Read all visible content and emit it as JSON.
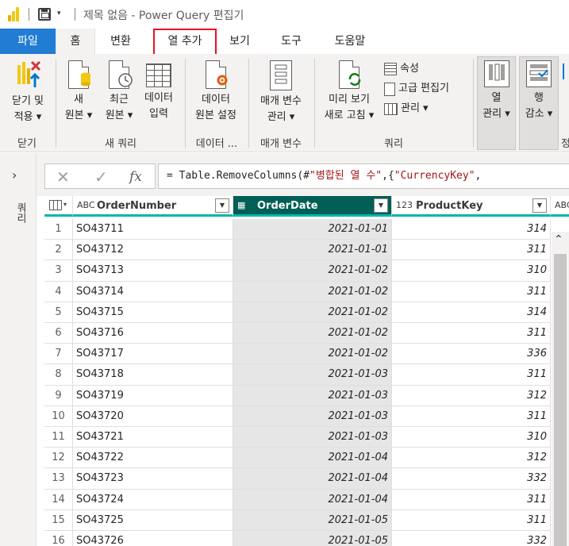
{
  "titlebar": {
    "title": "제목 없음 - Power Query 편집기",
    "qa_dropdown": "▾"
  },
  "tabs": {
    "file": "파일",
    "home": "홈",
    "transform": "변환",
    "add_column": "열 추가",
    "view": "보기",
    "tools": "도구",
    "help": "도움말"
  },
  "ribbon": {
    "close_apply": "닫기 및\n적용 ▾",
    "close_group": "닫기",
    "new_source": "새\n원본 ▾",
    "recent_sources": "최근\n원본 ▾",
    "enter_data": "데이터\n입력",
    "new_query_group": "새 쿼리",
    "data_source_settings": "데이터\n원본 설정",
    "data_source_group": "데이터 ...",
    "manage_parameters": "매개 변수\n관리 ▾",
    "parameters_group": "매개 변수",
    "refresh_preview": "미리 보기\n새로 고침 ▾",
    "properties": "속성",
    "advanced_editor": "고급 편집기",
    "manage": "관리 ▾",
    "query_group": "쿼리",
    "manage_columns": "열\n관리 ▾",
    "reduce_rows": "행\n감소 ▾",
    "truncated_group": "정"
  },
  "leftpane": {
    "expand": "›",
    "label": "쿼리"
  },
  "formula": {
    "cancel": "✕",
    "commit": "✓",
    "fx": "fx",
    "prefix": "= Table.RemoveColumns(#",
    "str1": "\"병합된 열 수\"",
    "mid": ",{",
    "str2": "\"CurrencyKey\"",
    "suffix": ","
  },
  "grid": {
    "columns": [
      {
        "type": "ABC",
        "name": "OrderNumber"
      },
      {
        "type": "▦",
        "name": "OrderDate"
      },
      {
        "type": "123",
        "name": "ProductKey"
      },
      {
        "type": "ABC",
        "name": ""
      }
    ],
    "rows": [
      [
        "1",
        "SO43711",
        "2021-01-01",
        "314"
      ],
      [
        "2",
        "SO43712",
        "2021-01-01",
        "311"
      ],
      [
        "3",
        "SO43713",
        "2021-01-02",
        "310"
      ],
      [
        "4",
        "SO43714",
        "2021-01-02",
        "311"
      ],
      [
        "5",
        "SO43715",
        "2021-01-02",
        "314"
      ],
      [
        "6",
        "SO43716",
        "2021-01-02",
        "311"
      ],
      [
        "7",
        "SO43717",
        "2021-01-02",
        "336"
      ],
      [
        "8",
        "SO43718",
        "2021-01-03",
        "311"
      ],
      [
        "9",
        "SO43719",
        "2021-01-03",
        "312"
      ],
      [
        "10",
        "SO43720",
        "2021-01-03",
        "311"
      ],
      [
        "11",
        "SO43721",
        "2021-01-03",
        "310"
      ],
      [
        "12",
        "SO43722",
        "2021-01-04",
        "312"
      ],
      [
        "13",
        "SO43723",
        "2021-01-04",
        "332"
      ],
      [
        "14",
        "SO43724",
        "2021-01-04",
        "311"
      ],
      [
        "15",
        "SO43725",
        "2021-01-05",
        "311"
      ],
      [
        "16",
        "SO43726",
        "2021-01-05",
        "332"
      ]
    ]
  },
  "scrollbar": {
    "up": "⌃"
  },
  "colors": {
    "accent": "#217cd4",
    "selected_col": "#005f57",
    "header_line": "#01b8aa",
    "highlight_box": "#e81123"
  }
}
